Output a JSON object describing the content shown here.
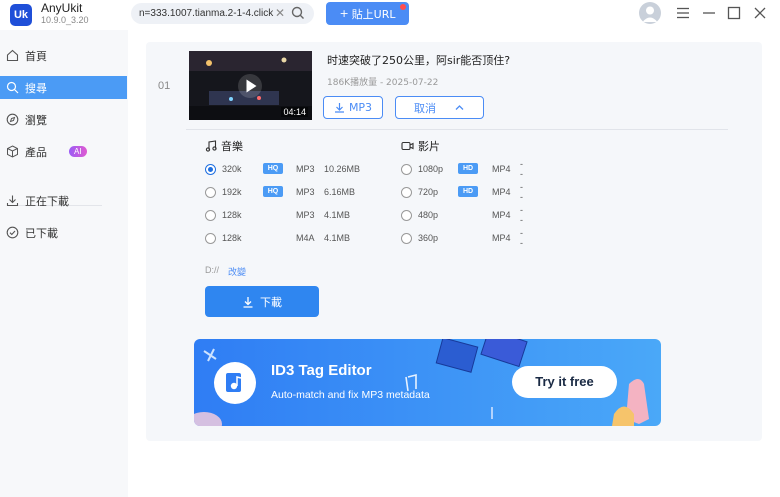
{
  "app": {
    "name": "AnyUkit",
    "version": "10.9.0_3.20",
    "logo_text": "Uk"
  },
  "toolbar": {
    "url_value": "n=333.1007.tianma.2-1-4.click",
    "paste_label": "貼上URL"
  },
  "sidebar": {
    "items": [
      {
        "label": "首頁",
        "icon": "home-icon"
      },
      {
        "label": "搜尋",
        "icon": "search-icon"
      },
      {
        "label": "瀏覽",
        "icon": "compass-icon"
      },
      {
        "label": "產品",
        "icon": "box-icon",
        "badge": "AI"
      },
      {
        "label": "正在下載",
        "icon": "download-icon"
      },
      {
        "label": "已下載",
        "icon": "check-circle-icon"
      }
    ]
  },
  "video": {
    "index": "01",
    "title": "时速突破了250公里，阿sir能否顶住?",
    "meta": "186K播放量 - 2025-07-22",
    "duration": "04:14",
    "mp3_label": "MP3",
    "cancel_label": "取消"
  },
  "options": {
    "music_label": "音樂",
    "video_label": "影片",
    "music": [
      {
        "quality": "320k",
        "badge": "HQ",
        "format": "MP3",
        "size": "10.26MB",
        "selected": true
      },
      {
        "quality": "192k",
        "badge": "HQ",
        "format": "MP3",
        "size": "6.16MB",
        "selected": false
      },
      {
        "quality": "128k",
        "badge": "",
        "format": "MP3",
        "size": "4.1MB",
        "selected": false
      },
      {
        "quality": "128k",
        "badge": "",
        "format": "M4A",
        "size": "4.1MB",
        "selected": false
      }
    ],
    "video": [
      {
        "quality": "1080p",
        "badge": "HD",
        "format": "MP4",
        "size": "--"
      },
      {
        "quality": "720p",
        "badge": "HD",
        "format": "MP4",
        "size": "--"
      },
      {
        "quality": "480p",
        "badge": "",
        "format": "MP4",
        "size": "--"
      },
      {
        "quality": "360p",
        "badge": "",
        "format": "MP4",
        "size": "--"
      }
    ]
  },
  "path": {
    "value": "D://",
    "change_label": "改變"
  },
  "download_label": "下載",
  "banner": {
    "title": "ID3 Tag Editor",
    "subtitle": "Auto-match and fix MP3 metadata",
    "cta": "Try it free"
  },
  "colors": {
    "accent": "#4b8cf5",
    "active_nav": "#4b9bf5",
    "download_button": "#2f86f0"
  }
}
